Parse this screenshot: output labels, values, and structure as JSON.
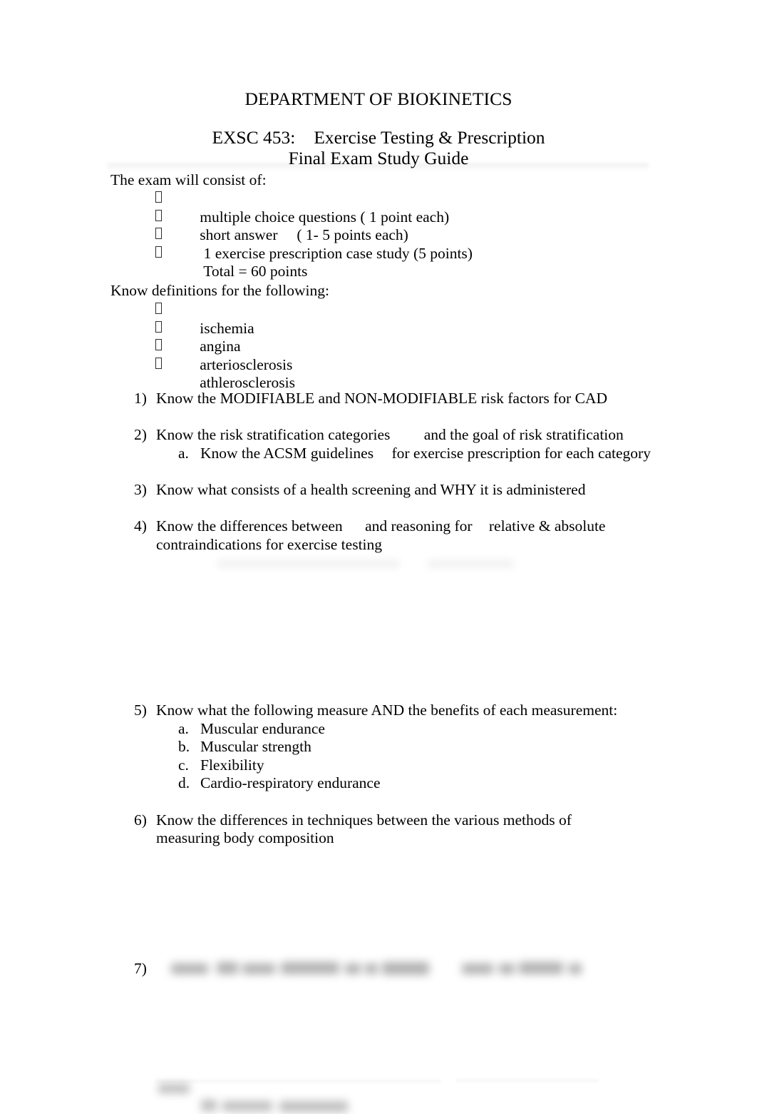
{
  "document": {
    "department_title": "DEPARTMENT OF BIOKINETICS",
    "course_code": "EXSC 453:",
    "course_name": "Exercise Testing & Prescription",
    "subtitle": "Final Exam Study Guide"
  },
  "exam_section": {
    "lead": "The exam will consist of:",
    "bullet_glyph": "missing-glyph-box",
    "items": [
      "multiple choice questions ( 1 point each)",
      "short answer     ( 1- 5 points each)",
      " 1 exercise prescription case study (5 points)",
      " Total = 60 points"
    ]
  },
  "definitions_section": {
    "lead": "Know definitions for the following:",
    "items": [
      "ischemia",
      "angina",
      "arteriosclerosis",
      "athlerosclerosis"
    ]
  },
  "numbered_items": [
    {
      "marker": "1)",
      "text": "Know the MODIFIABLE and NON-MODIFIABLE risk factors for CAD",
      "subitems": []
    },
    {
      "marker": "2)",
      "text_part1": "Know the  risk stratification categories",
      "text_part2": "and the   goal of risk stratification",
      "subitems": [
        {
          "marker": "a.",
          "text_part1": "Know the ACSM guidelines",
          "text_part2": "for exercise prescription for each category"
        }
      ]
    },
    {
      "marker": "3)",
      "text": "Know what consists of a health screening and WHY it is administered",
      "subitems": []
    },
    {
      "marker": "4)",
      "text_part1": "Know the differences between",
      "text_part2": "and reasoning for",
      "text_part3": "relative & absolute contraindications for exercise testing",
      "subitems": []
    },
    {
      "marker": "5)",
      "text": "Know what the following measure AND the benefits of each measurement:",
      "subitems": [
        {
          "marker": "a.",
          "text": "Muscular endurance"
        },
        {
          "marker": "b.",
          "text": "Muscular strength"
        },
        {
          "marker": "c.",
          "text": "Flexibility"
        },
        {
          "marker": "d.",
          "text": "Cardio-respiratory endurance"
        }
      ]
    },
    {
      "marker": "6)",
      "text": "Know the differences in techniques between the various methods of measuring body composition",
      "subitems": []
    },
    {
      "marker": "7)",
      "text": "",
      "note": "text is blurred and illegible in the source image",
      "subitems": []
    }
  ],
  "colors": {
    "page_background": "#ffffff",
    "text": "#000000",
    "faint_shade": "rgba(0,0,0,0.05)"
  }
}
